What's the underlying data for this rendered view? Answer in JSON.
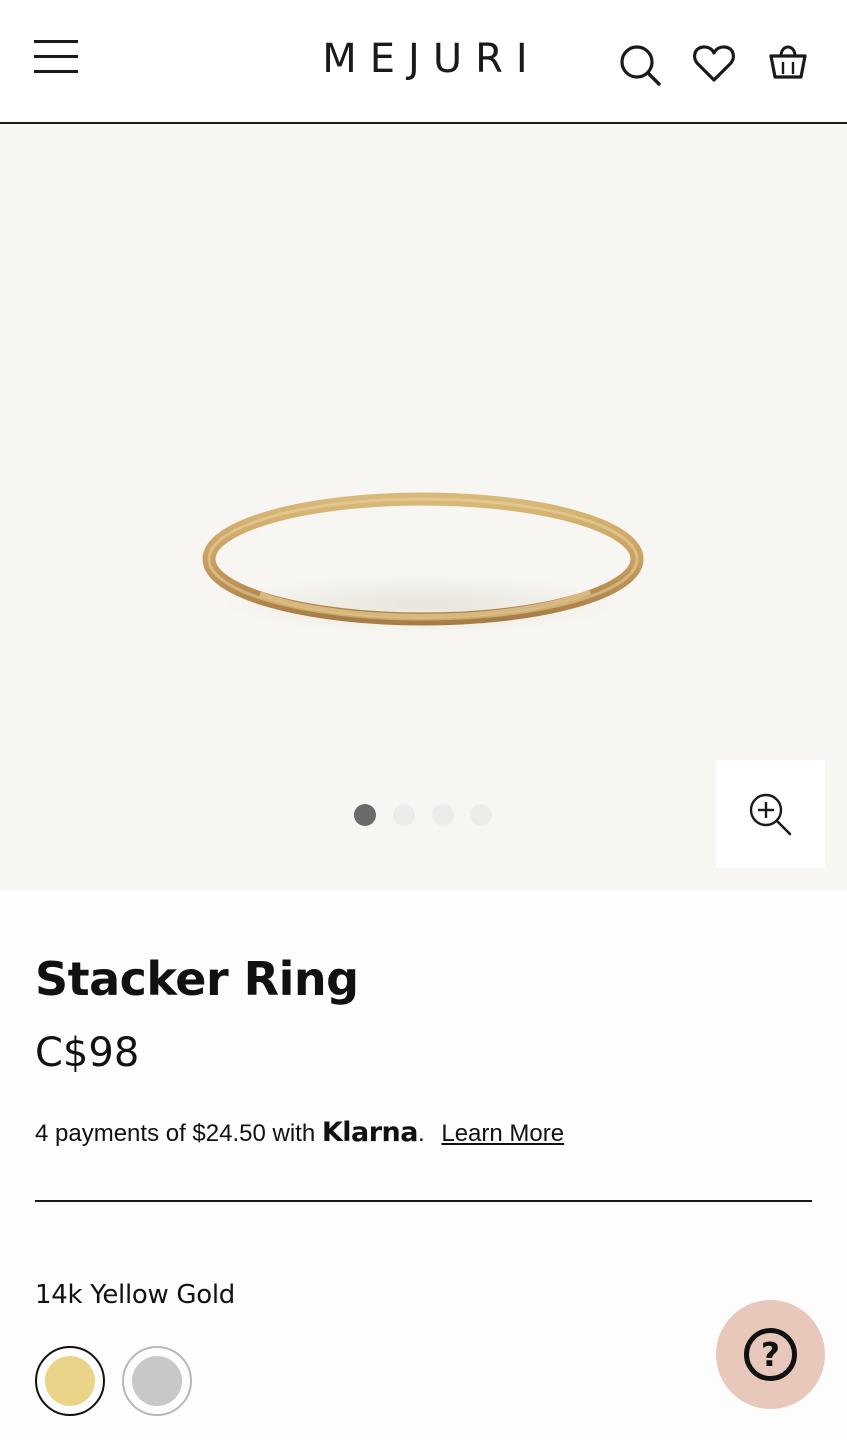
{
  "header": {
    "brand": "MEJURI",
    "icons": [
      "menu-icon",
      "search-icon",
      "heart-icon",
      "shopping-bag-icon"
    ]
  },
  "gallery": {
    "image_count": 4,
    "active_index": 0,
    "zoom_icon": "zoom-in-icon"
  },
  "product": {
    "title": "Stacker Ring",
    "price": "C$98",
    "klarna": {
      "text": "4 payments of $24.50 with",
      "brand": "Klarna",
      "period": ".",
      "link": "Learn More"
    },
    "material_label": "14k Yellow Gold",
    "swatches": [
      {
        "name": "yellow-gold",
        "color": "#e9d48a",
        "selected": true
      },
      {
        "name": "silver",
        "color": "#c8c8c8",
        "selected": false
      }
    ]
  },
  "help": {
    "icon": "question-mark-icon",
    "glyph": "?"
  },
  "colors": {
    "hero_background": "#f7f6f2",
    "help_background": "#e8c8bb",
    "gold_swatch": "#e9d48a",
    "silver_swatch": "#c8c8c8"
  }
}
